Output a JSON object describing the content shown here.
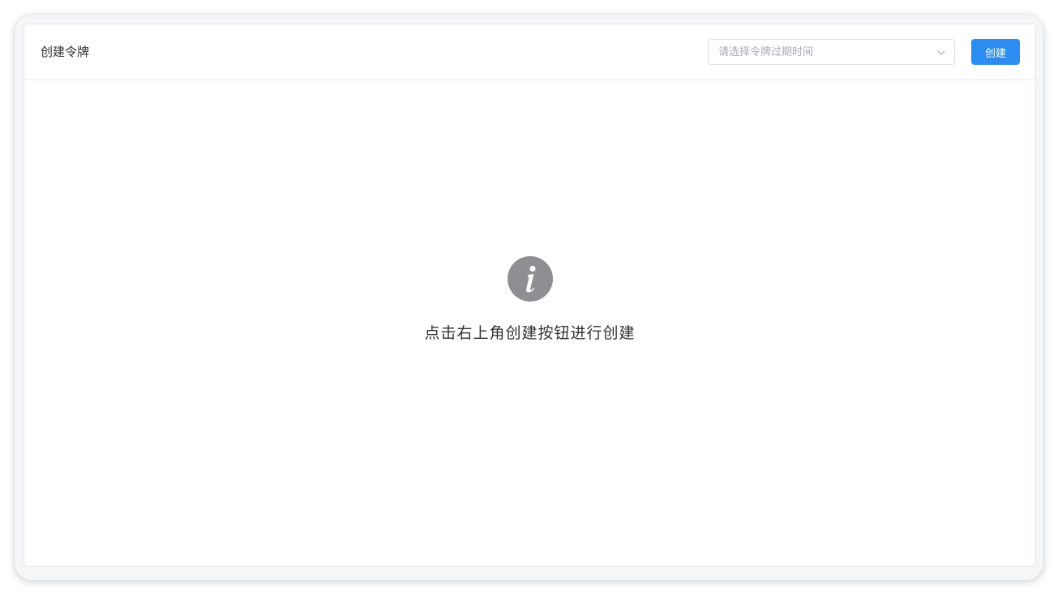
{
  "header": {
    "title": "创建令牌",
    "expiry_select": {
      "placeholder": "请选择令牌过期时间"
    },
    "create_label": "创建"
  },
  "empty_state": {
    "icon": "info-icon",
    "message": "点击右上角创建按钮进行创建"
  },
  "colors": {
    "primary": "#2d8cf0",
    "icon_gray": "#8e8e93",
    "border": "#e4e7ed"
  }
}
